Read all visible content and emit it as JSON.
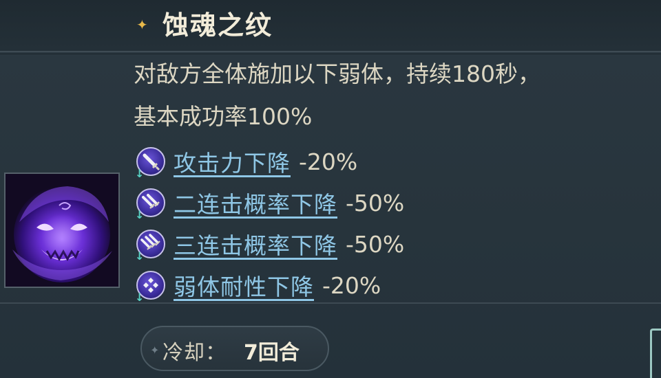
{
  "skill": {
    "title": "蚀魂之纹",
    "description_line1": "对敌方全体施加以下弱体，持续180秒，",
    "description_line2": "基本成功率100%"
  },
  "debuffs": [
    {
      "name": "攻击力下降",
      "value": "-20%",
      "icon": "sword-icon"
    },
    {
      "name": "二连击概率下降",
      "value": "-50%",
      "icon": "double-sword-icon"
    },
    {
      "name": "三连击概率下降",
      "value": "-50%",
      "icon": "triple-sword-icon"
    },
    {
      "name": "弱体耐性下降",
      "value": "-20%",
      "icon": "diamond-resist-icon"
    }
  ],
  "cooldown": {
    "label": "冷却：",
    "value": "7回合"
  },
  "colors": {
    "background": "#27343c",
    "title": "#f2ecd9",
    "link": "#8fc7e6",
    "accent": "#e9b94a",
    "debuff_badge": "#3a2c9a"
  }
}
